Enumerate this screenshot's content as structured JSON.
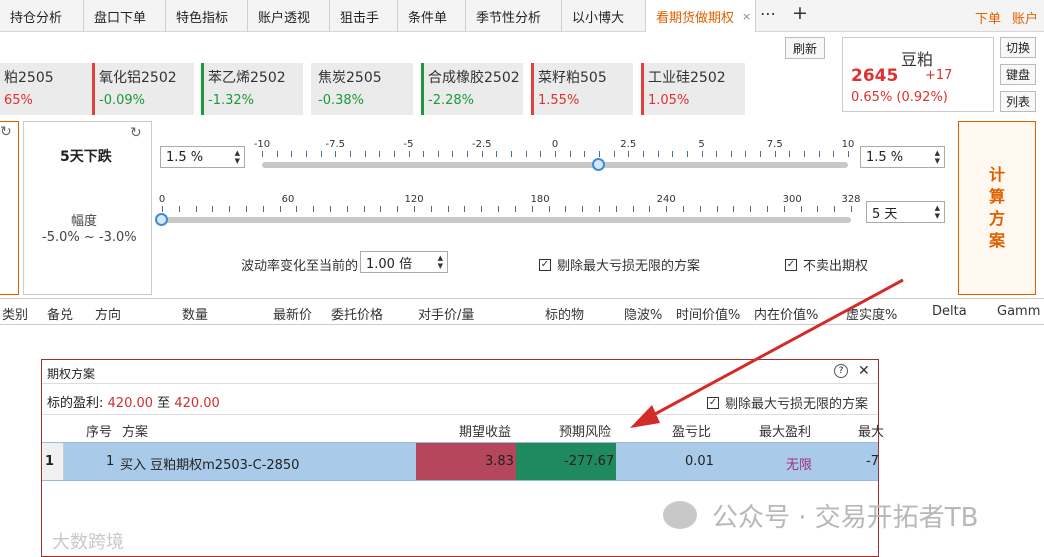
{
  "tabs": [
    {
      "label": "持仓分析"
    },
    {
      "label": "盘口下单"
    },
    {
      "label": "特色指标"
    },
    {
      "label": "账户透视"
    },
    {
      "label": "狙击手"
    },
    {
      "label": "条件单"
    },
    {
      "label": "季节性分析"
    },
    {
      "label": "以小博大"
    },
    {
      "label": "看期货做期权",
      "close": "×"
    }
  ],
  "tab_more": "⋯",
  "tab_add": "+",
  "top_right": {
    "order": "下单",
    "account": "账户"
  },
  "quotes": [
    {
      "name": "粕2505",
      "change": "65%",
      "dir": "up"
    },
    {
      "name": "氧化铝2502",
      "change": "-0.09%",
      "dir": "down"
    },
    {
      "name": "苯乙烯2502",
      "change": "-1.32%",
      "dir": "down"
    },
    {
      "name": "焦炭2505",
      "change": "-0.38%",
      "dir": "down"
    },
    {
      "name": "合成橡胶2502",
      "change": "-2.28%",
      "dir": "down"
    },
    {
      "name": "菜籽粕505",
      "change": "1.55%",
      "dir": "up"
    },
    {
      "name": "工业硅2502",
      "change": "1.05%",
      "dir": "up"
    }
  ],
  "refresh_label": "刷新",
  "summary": {
    "name": "豆粕",
    "price": "2645",
    "change": "+17",
    "pct": "0.65% (0.92%)"
  },
  "side_buttons": {
    "switch": "切换",
    "book": "键盘",
    "list": "列表"
  },
  "scenario": {
    "title": "5天下跌",
    "range_label": "幅度",
    "range": "-5.0% ~ -3.0%"
  },
  "price_slider": {
    "ticks": [
      "-10",
      "-7.5",
      "-5",
      "-2.5",
      "0",
      "2.5",
      "5",
      "7.5",
      "10"
    ],
    "value": 1.5,
    "left_input": "1.5 %",
    "right_input": "1.5 %"
  },
  "day_slider": {
    "ticks": [
      "0",
      "60",
      "120",
      "180",
      "240",
      "300",
      "328"
    ],
    "value": 0,
    "right_input": "5 天"
  },
  "vol_label": "波动率变化至当前的",
  "vol_input": "1.00 倍",
  "cb_exclude": "剔除最大亏损无限的方案",
  "cb_nosell": "不卖出期权",
  "calc_button": "计\n算\n方\n案",
  "table_headers": [
    "类别",
    "备兑",
    "方向",
    "数量",
    "最新价",
    "委托价格",
    "对手价/量",
    "标的物",
    "隐波%",
    "时间价值%",
    "内在价值%",
    "虚实度%",
    "Delta",
    "Gamm"
  ],
  "dialog": {
    "title": "期权方案",
    "profit_label": "标的盈利:",
    "profit_from": "420.00",
    "profit_to_label": "至",
    "profit_to": "420.00",
    "cb_label": "剔除最大亏损无限的方案",
    "headers": [
      "序号",
      "方案",
      "期望收益",
      "预期风险",
      "盈亏比",
      "最大盈利",
      "最大"
    ],
    "row": {
      "index": "1",
      "seq": "1",
      "plan": "买入 豆粕期权m2503-C-2850",
      "expected": "3.83",
      "risk": "-277.67",
      "ratio": "0.01",
      "max_profit": "无限",
      "max_loss": "-7"
    }
  },
  "watermark": "公众号 · 交易开拓者TB",
  "watermark2": "大数跨境",
  "colors": {
    "accent": "#e06000",
    "up": "#e03030",
    "down": "#1a9a3a",
    "row": "#a9cbe9",
    "expected": "#b5475c",
    "risk": "#1f8a5e"
  }
}
